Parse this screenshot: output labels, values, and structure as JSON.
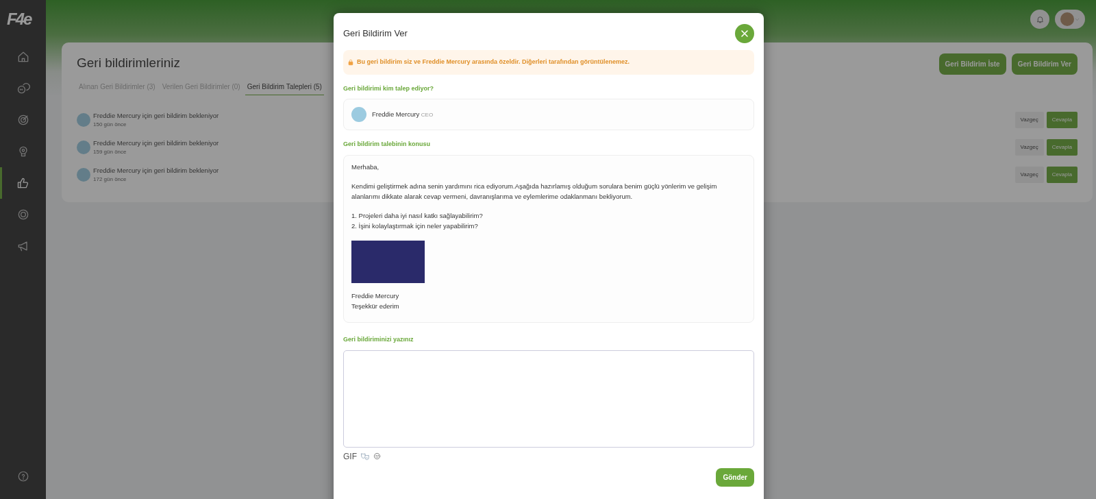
{
  "sidebar": {
    "logo": "F4e",
    "items": [
      {
        "selected": false
      },
      {
        "selected": false
      },
      {
        "selected": false
      },
      {
        "selected": false
      },
      {
        "selected": true
      },
      {
        "selected": false
      },
      {
        "selected": false
      }
    ]
  },
  "page": {
    "title": "Geri bildirimleriniz",
    "buttons": [
      "Geri Bildirim İste",
      "Geri Bildirim Ver"
    ],
    "tabs": [
      {
        "label": "Alınan Geri Bildirimler (3)",
        "selected": false
      },
      {
        "label": "Verilen Geri Bildirimler (0)",
        "selected": false
      },
      {
        "label": "Geri Bildirim Talepleri (5)",
        "selected": true
      }
    ],
    "requests": [
      {
        "text": "Freddie Mercury için geri bildirim bekleniyor",
        "time": "150 gün önce",
        "cancel": "Vazgeç",
        "reply": "Cevapla"
      },
      {
        "text": "Freddie Mercury için geri bildirim bekleniyor",
        "time": "159 gün önce",
        "cancel": "Vazgeç",
        "reply": "Cevapla"
      },
      {
        "text": "Freddie Mercury için geri bildirim bekleniyor",
        "time": "172 gün önce",
        "cancel": "Vazgeç",
        "reply": "Cevapla"
      }
    ]
  },
  "modal": {
    "title": "Geri Bildirim Ver",
    "notice": "Bu geri bildirim siz ve Freddie Mercury arasında özeldir. Diğerleri tarafından görüntülenemez.",
    "requester_label": "Geri bildirimi kim talep ediyor?",
    "requester": {
      "name": "Freddie Mercury",
      "role": "CEO"
    },
    "subject_label": "Geri bildirim talebinin konusu",
    "message": [
      {
        "kind": "text",
        "lines": [
          "Merhaba,"
        ]
      },
      {
        "kind": "text",
        "lines": [
          "Kendimi geliştirmek adına senin yardımını rica ediyorum.Aşağıda hazırlamış olduğum sorulara benim güçlü yönlerim ve gelişim alanlarımı dikkate alarak cevap vermeni, davranışlarıma ve eylemlerime odaklanmanı bekliyorum."
        ]
      },
      {
        "kind": "text",
        "lines": [
          "1. Projeleri daha iyi nasıl katkı sağlayabilirim?",
          "2. İşini kolaylaştırmak için neler yapabilirim?"
        ]
      },
      {
        "kind": "image"
      },
      {
        "kind": "text",
        "lines": [
          "Freddie Mercury",
          "Teşekkür ederim"
        ]
      }
    ],
    "feedback_label": "Geri bildiriminizi yazınız",
    "gif": "GIF",
    "submit": "Gönder"
  }
}
